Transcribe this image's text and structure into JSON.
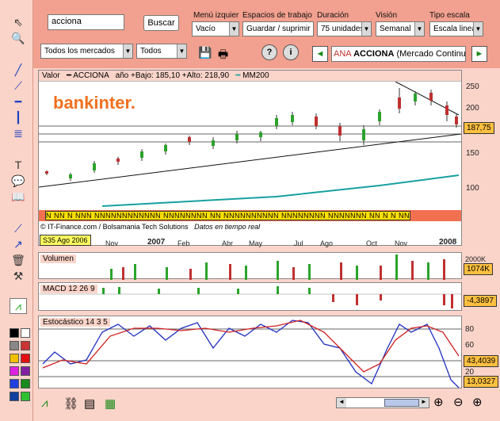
{
  "search": {
    "value": "acciona",
    "button": "Buscar"
  },
  "filters": {
    "market": "Todos los mercados",
    "type": "Todos"
  },
  "menus": {
    "menu_izq_label": "Menú izquier",
    "menu_izq_value": "Vacío",
    "espacios_label": "Espacios de trabajo",
    "espacios_value": "Guardar / suprimir",
    "duracion_label": "Duración",
    "duracion_value": "75 unidades",
    "vision_label": "Visión",
    "vision_value": "Semanal",
    "escala_label": "Tipo escala",
    "escala_value": "Escala lineal"
  },
  "ticker": {
    "prefix": "ANA",
    "name": "ACCIONA",
    "market": "(Mercado Continu"
  },
  "price_panel": {
    "label": "Valor",
    "series": "ACCIONA",
    "stats": "año +Bajo: 185,10 +Alto: 218,90",
    "ma": "MM200",
    "logo": "bankinter.",
    "credit": "© IT-Finance.com / Bolsamania Tech Solutions",
    "realtime": "Datos en tiempo real",
    "last": "187,75",
    "date_tag": "S35 Ago 2006"
  },
  "y_axis": [
    "250",
    "200",
    "150",
    "100"
  ],
  "months": [
    "Nov",
    "2007",
    "Feb",
    "Abr",
    "May",
    "Jul",
    "Ago",
    "Oct",
    "Nov",
    "2008"
  ],
  "news_tags": "N NN N NNN NNNNNNNNNNNN NNNNNNNN NN NNNNNNNNNN NNNNNNNN NNNNNNN NN N N NN",
  "volume": {
    "label": "Volumen",
    "value": "1074K",
    "axis": "2000K"
  },
  "macd": {
    "label": "MACD 12 26 9",
    "value": "-4,3897"
  },
  "stoch": {
    "label": "Estocástico 14 3 5",
    "k": "43,4039",
    "d": "13,0327",
    "axis": [
      "80",
      "60",
      "40",
      "20"
    ]
  },
  "colors": {
    "bg": "#fbd4c9",
    "accent": "#f2a08f",
    "candle_up": "#2ba32b",
    "candle_dn": "#c03030",
    "ma": "#18a0a0",
    "logo": "#f07020"
  }
}
